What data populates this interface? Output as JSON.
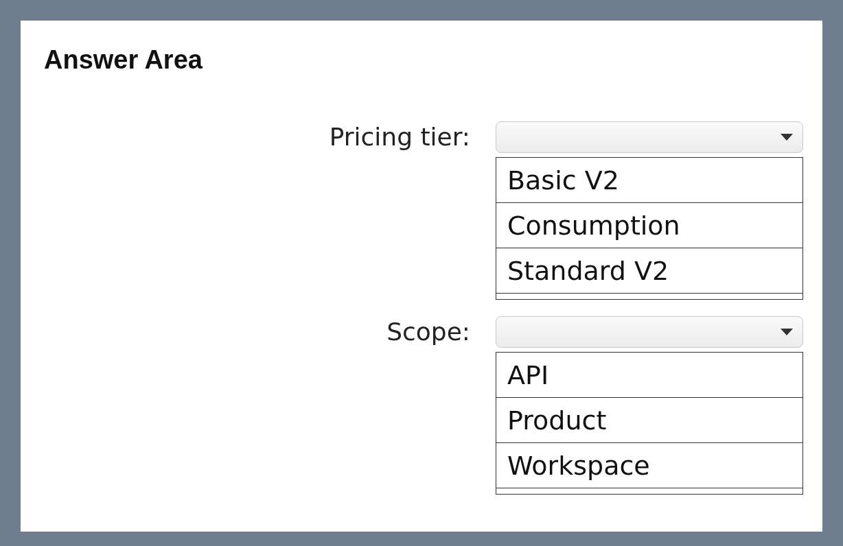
{
  "title": "Answer Area",
  "questions": [
    {
      "label": "Pricing tier:",
      "options": [
        "Basic V2",
        "Consumption",
        "Standard V2"
      ]
    },
    {
      "label": "Scope:",
      "options": [
        "API",
        "Product",
        "Workspace"
      ]
    }
  ]
}
